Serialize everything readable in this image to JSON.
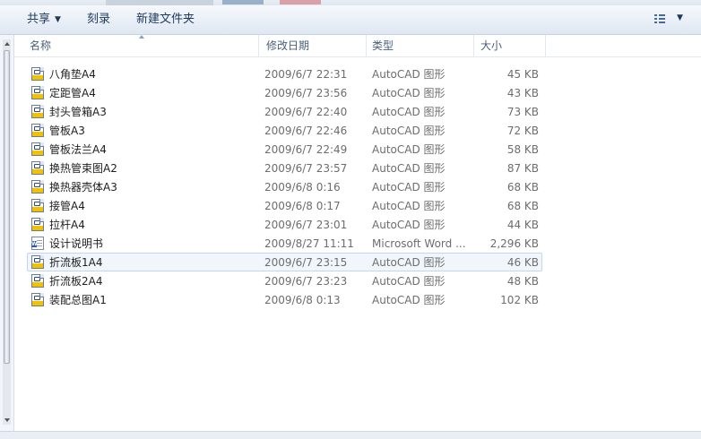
{
  "toolbar": {
    "share_label": "共享",
    "burn_label": "刻录",
    "new_folder_label": "新建文件夹",
    "view_icon": "details-view-icon"
  },
  "columns": {
    "name": "名称",
    "date": "修改日期",
    "type": "类型",
    "size": "大小",
    "sort": "ascending"
  },
  "files": [
    {
      "name": "八角垫A4",
      "date": "2009/6/7 22:31",
      "type": "AutoCAD 图形",
      "size": "45 KB",
      "icon": "autocad-dwg-icon"
    },
    {
      "name": "定距管A4",
      "date": "2009/6/7 23:56",
      "type": "AutoCAD 图形",
      "size": "43 KB",
      "icon": "autocad-dwg-icon"
    },
    {
      "name": "封头管箱A3",
      "date": "2009/6/7 22:40",
      "type": "AutoCAD 图形",
      "size": "73 KB",
      "icon": "autocad-dwg-icon"
    },
    {
      "name": "管板A3",
      "date": "2009/6/7 22:46",
      "type": "AutoCAD 图形",
      "size": "72 KB",
      "icon": "autocad-dwg-icon"
    },
    {
      "name": "管板法兰A4",
      "date": "2009/6/7 22:49",
      "type": "AutoCAD 图形",
      "size": "58 KB",
      "icon": "autocad-dwg-icon"
    },
    {
      "name": "换热管束图A2",
      "date": "2009/6/7 23:57",
      "type": "AutoCAD 图形",
      "size": "87 KB",
      "icon": "autocad-dwg-icon"
    },
    {
      "name": "换热器壳体A3",
      "date": "2009/6/8 0:16",
      "type": "AutoCAD 图形",
      "size": "68 KB",
      "icon": "autocad-dwg-icon"
    },
    {
      "name": "接管A4",
      "date": "2009/6/8 0:17",
      "type": "AutoCAD 图形",
      "size": "68 KB",
      "icon": "autocad-dwg-icon"
    },
    {
      "name": "拉杆A4",
      "date": "2009/6/7 23:01",
      "type": "AutoCAD 图形",
      "size": "44 KB",
      "icon": "autocad-dwg-icon"
    },
    {
      "name": "设计说明书",
      "date": "2009/8/27 11:11",
      "type": "Microsoft Word ...",
      "size": "2,296 KB",
      "icon": "word-doc-icon"
    },
    {
      "name": "折流板1A4",
      "date": "2009/6/7 23:15",
      "type": "AutoCAD 图形",
      "size": "46 KB",
      "icon": "autocad-dwg-icon",
      "selected": true
    },
    {
      "name": "折流板2A4",
      "date": "2009/6/7 23:23",
      "type": "AutoCAD 图形",
      "size": "48 KB",
      "icon": "autocad-dwg-icon"
    },
    {
      "name": "装配总图A1",
      "date": "2009/6/8 0:13",
      "type": "AutoCAD 图形",
      "size": "102 KB",
      "icon": "autocad-dwg-icon"
    }
  ]
}
